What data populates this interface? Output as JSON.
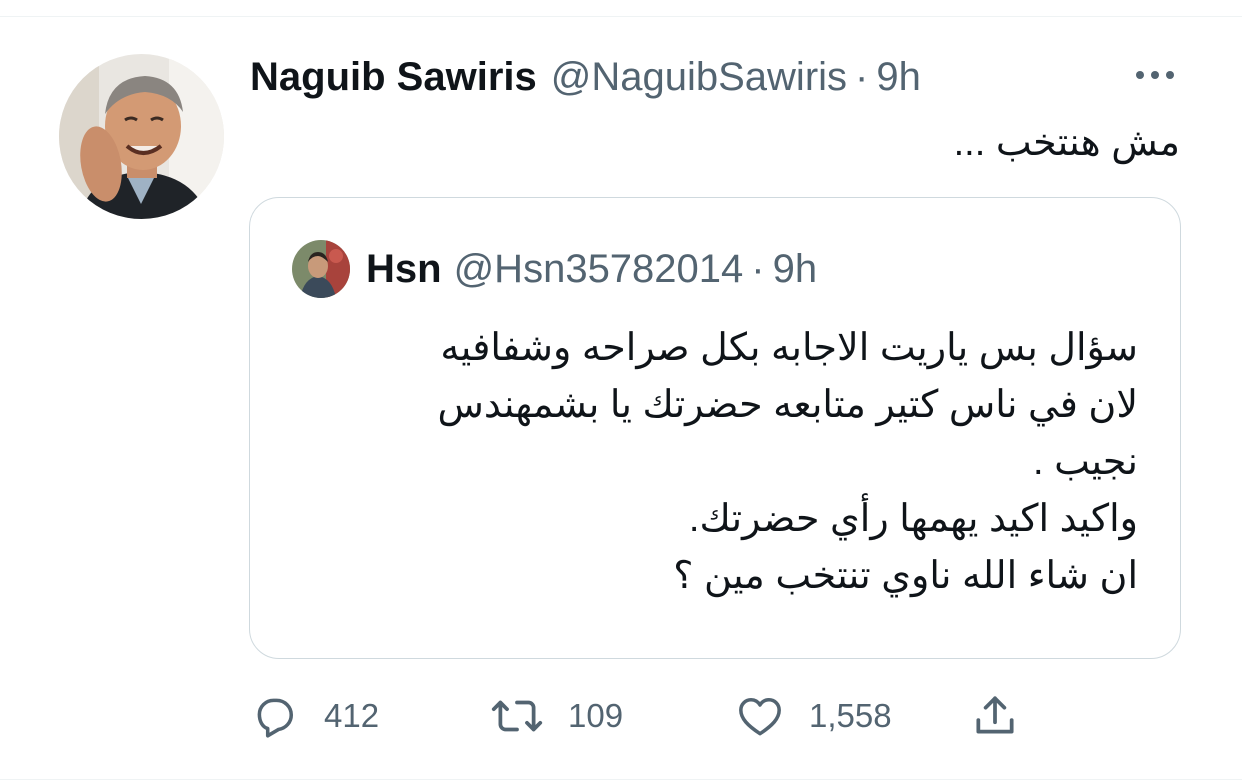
{
  "tweet": {
    "author": {
      "name": "Naguib Sawiris",
      "handle": "@NaguibSawiris",
      "avatar_icon": "profile-photo"
    },
    "separator": "·",
    "time": "9h",
    "text": "مش هنتخب ...",
    "more_icon": "more-dots-icon"
  },
  "quoted": {
    "author": {
      "name": "Hsn",
      "handle": "@Hsn35782014",
      "avatar_icon": "profile-photo"
    },
    "separator": "·",
    "time": "9h",
    "lines": [
      "سؤال بس ياريت الاجابه بكل صراحه وشفافيه",
      "لان في ناس كتير متابعه حضرتك يا بشمهندس",
      "نجيب .",
      "واكيد اكيد يهمها رأي حضرتك.",
      "ان شاء الله ناوي تنتخب مين ؟"
    ]
  },
  "actions": {
    "reply": {
      "icon": "reply-icon",
      "count": "412"
    },
    "retweet": {
      "icon": "retweet-icon",
      "count": "109"
    },
    "like": {
      "icon": "heart-icon",
      "count": "1,558"
    },
    "share": {
      "icon": "share-icon"
    }
  },
  "colors": {
    "text": "#0f1419",
    "secondary": "#536471",
    "border": "#cfd9de"
  }
}
